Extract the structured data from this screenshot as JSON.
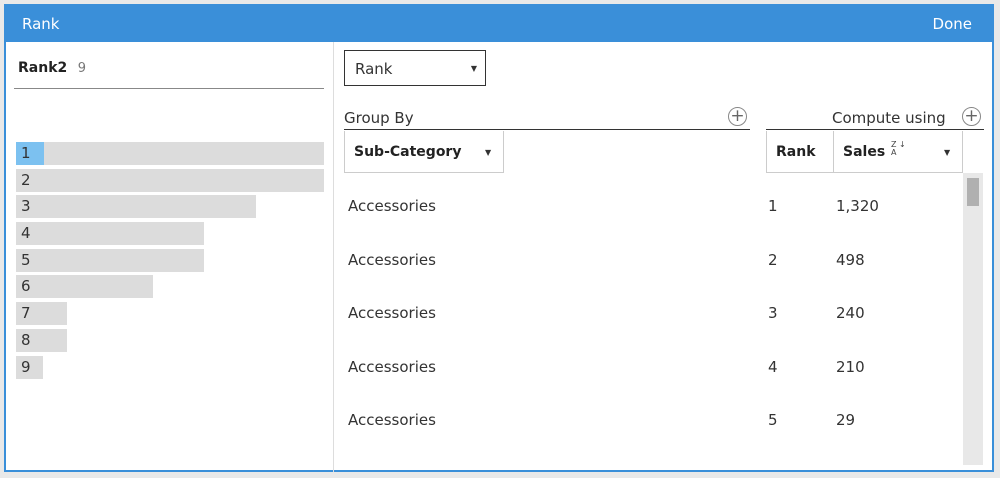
{
  "dialog": {
    "title": "Rank",
    "done_label": "Done"
  },
  "field": {
    "name": "Rank2",
    "count": "9"
  },
  "distribution": [
    {
      "label": "1",
      "value": 9,
      "selected": true
    },
    {
      "label": "2",
      "value": 9
    },
    {
      "label": "3",
      "value": 7
    },
    {
      "label": "4",
      "value": 5.5
    },
    {
      "label": "5",
      "value": 5.5
    },
    {
      "label": "6",
      "value": 4
    },
    {
      "label": "7",
      "value": 1.5
    },
    {
      "label": "8",
      "value": 1.5
    },
    {
      "label": "9",
      "value": 0.8
    }
  ],
  "calc_type": {
    "selected": "Rank"
  },
  "group_by": {
    "label": "Group By",
    "column": "Sub-Category"
  },
  "compute_using": {
    "label": "Compute using",
    "rank_col": "Rank",
    "sales_col": "Sales",
    "sort": "descending"
  },
  "rows": [
    {
      "sub_category": "Accessories",
      "rank": "1",
      "sales": "1,320"
    },
    {
      "sub_category": "Accessories",
      "rank": "2",
      "sales": "498"
    },
    {
      "sub_category": "Accessories",
      "rank": "3",
      "sales": "240"
    },
    {
      "sub_category": "Accessories",
      "rank": "4",
      "sales": "210"
    },
    {
      "sub_category": "Accessories",
      "rank": "5",
      "sales": "29"
    }
  ],
  "colors": {
    "accent": "#3a8fd9",
    "bar": "#dcdcdc",
    "bar_selected": "#7cc1f0"
  },
  "icons": {
    "add": "plus-circle-icon",
    "dropdown": "caret-down-icon",
    "sort": "sort-za-icon"
  }
}
